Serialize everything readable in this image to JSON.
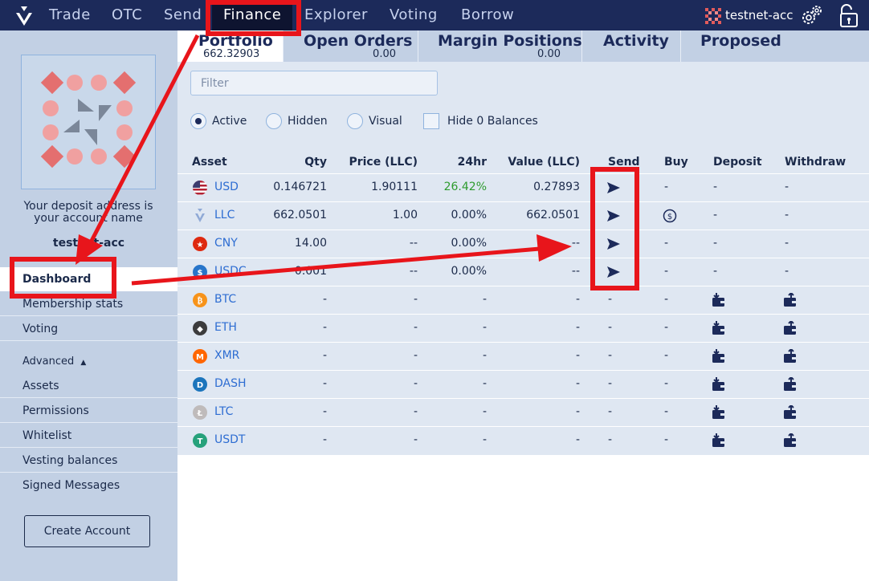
{
  "nav": {
    "items": [
      "Trade",
      "OTC",
      "Send",
      "Finance",
      "Explorer",
      "Voting",
      "Borrow"
    ],
    "active": "Finance",
    "account": "testnet-acc"
  },
  "sidebar": {
    "deposit_note_1": "Your deposit address is",
    "deposit_note_2": "your account name",
    "account_label": "testnet-acc",
    "items": [
      "Dashboard",
      "Membership stats",
      "Voting"
    ],
    "advanced_label": "Advanced",
    "advanced_items": [
      "Assets",
      "Permissions",
      "Whitelist",
      "Vesting balances",
      "Signed Messages"
    ],
    "create_account": "Create Account"
  },
  "tabs": [
    {
      "label": "Portfolio",
      "sub": "662.32903"
    },
    {
      "label": "Open Orders",
      "sub": "0.00"
    },
    {
      "label": "Margin Positions",
      "sub": "0.00"
    },
    {
      "label": "Activity",
      "sub": ""
    },
    {
      "label": "Proposed",
      "sub": ""
    }
  ],
  "filter": {
    "placeholder": "Filter"
  },
  "view_options": {
    "active": "Active",
    "hidden": "Hidden",
    "visual": "Visual",
    "hide_zero": "Hide 0 Balances",
    "selected": "Active"
  },
  "table": {
    "headers": [
      "Asset",
      "Qty",
      "Price (LLC)",
      "24hr",
      "Value (LLC)",
      "Send",
      "Buy",
      "Deposit",
      "Withdraw"
    ],
    "rows": [
      {
        "asset": "USD",
        "qty": "0.146721",
        "price": "1.90111",
        "change": "26.42%",
        "value": "0.27893",
        "send": "send-icon",
        "buy": "-",
        "deposit": "-",
        "withdraw": "-"
      },
      {
        "asset": "LLC",
        "qty": "662.0501",
        "price": "1.00",
        "change": "0.00%",
        "value": "662.0501",
        "send": "send-icon",
        "buy": "dollar-coin-icon",
        "deposit": "-",
        "withdraw": "-"
      },
      {
        "asset": "CNY",
        "qty": "14.00",
        "price": "--",
        "change": "0.00%",
        "value": "--",
        "send": "send-icon",
        "buy": "-",
        "deposit": "-",
        "withdraw": "-"
      },
      {
        "asset": "USDC",
        "qty": "0.001",
        "price": "--",
        "change": "0.00%",
        "value": "--",
        "send": "send-icon",
        "buy": "-",
        "deposit": "-",
        "withdraw": "-"
      },
      {
        "asset": "BTC",
        "qty": "-",
        "price": "-",
        "change": "-",
        "value": "-",
        "send": "-",
        "buy": "-",
        "deposit": "deposit-icon",
        "withdraw": "withdraw-icon"
      },
      {
        "asset": "ETH",
        "qty": "-",
        "price": "-",
        "change": "-",
        "value": "-",
        "send": "-",
        "buy": "-",
        "deposit": "deposit-icon",
        "withdraw": "withdraw-icon"
      },
      {
        "asset": "XMR",
        "qty": "-",
        "price": "-",
        "change": "-",
        "value": "-",
        "send": "-",
        "buy": "-",
        "deposit": "deposit-icon",
        "withdraw": "withdraw-icon"
      },
      {
        "asset": "DASH",
        "qty": "-",
        "price": "-",
        "change": "-",
        "value": "-",
        "send": "-",
        "buy": "-",
        "deposit": "deposit-icon",
        "withdraw": "withdraw-icon"
      },
      {
        "asset": "LTC",
        "qty": "-",
        "price": "-",
        "change": "-",
        "value": "-",
        "send": "-",
        "buy": "-",
        "deposit": "deposit-icon",
        "withdraw": "withdraw-icon"
      },
      {
        "asset": "USDT",
        "qty": "-",
        "price": "-",
        "change": "-",
        "value": "-",
        "send": "-",
        "buy": "-",
        "deposit": "deposit-icon",
        "withdraw": "withdraw-icon"
      }
    ]
  },
  "colors": {
    "nav_bg": "#1c2a5a",
    "sidebar_bg": "#c2d0e4",
    "content_bg": "#dfe7f2",
    "link": "#2e6dd2",
    "positive": "#2e9b2e",
    "annotation": "#e8151b"
  }
}
